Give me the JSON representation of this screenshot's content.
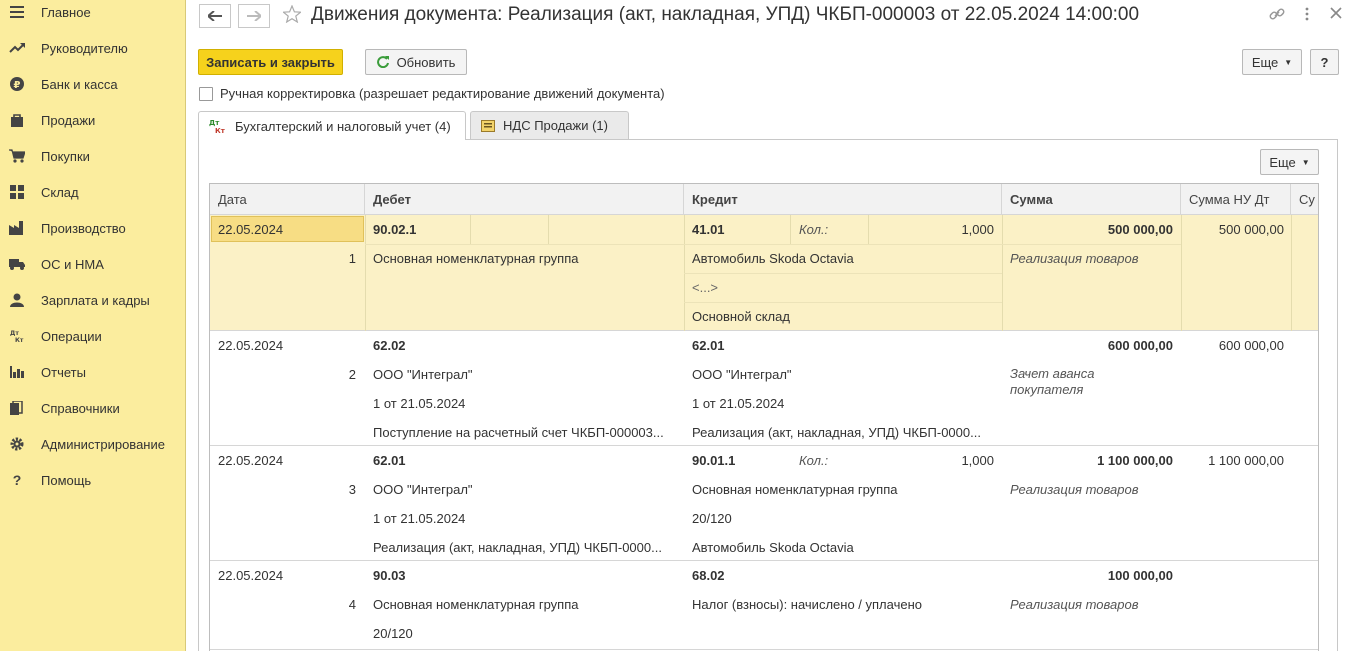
{
  "sidebar": {
    "items": [
      {
        "label": "Главное",
        "icon": "menu-icon"
      },
      {
        "label": "Руководителю",
        "icon": "trend-icon"
      },
      {
        "label": "Банк и касса",
        "icon": "ruble-icon"
      },
      {
        "label": "Продажи",
        "icon": "bag-icon"
      },
      {
        "label": "Покупки",
        "icon": "cart-icon"
      },
      {
        "label": "Склад",
        "icon": "warehouse-icon"
      },
      {
        "label": "Производство",
        "icon": "factory-icon"
      },
      {
        "label": "ОС и НМА",
        "icon": "truck-icon"
      },
      {
        "label": "Зарплата и кадры",
        "icon": "person-icon"
      },
      {
        "label": "Операции",
        "icon": "dt-kt-icon"
      },
      {
        "label": "Отчеты",
        "icon": "bar-chart-icon"
      },
      {
        "label": "Справочники",
        "icon": "books-icon"
      },
      {
        "label": "Администрирование",
        "icon": "gear-icon"
      },
      {
        "label": "Помощь",
        "icon": "question-icon"
      }
    ]
  },
  "header": {
    "title": "Движения документа: Реализация (акт, накладная, УПД) ЧКБП-000003 от 22.05.2024 14:00:00"
  },
  "toolbar": {
    "save_close": "Записать и закрыть",
    "refresh": "Обновить",
    "more": "Еще",
    "help": "?",
    "manual_edit": "Ручная корректировка (разрешает редактирование движений документа)"
  },
  "tabs": [
    {
      "label": "Бухгалтерский и налоговый учет (4)",
      "icon_top": "Дт",
      "icon_bottom": "Кт"
    },
    {
      "label": "НДС Продажи (1)"
    }
  ],
  "grid": {
    "more": "Еще",
    "columns": [
      "Дата",
      "Дебет",
      "Кредит",
      "Сумма",
      "Сумма НУ Дт",
      "Су"
    ],
    "rows": [
      {
        "date": "22.05.2024",
        "num": "1",
        "debit": [
          "90.02.1",
          "Основная номенклатурная группа",
          "",
          ""
        ],
        "credit": [
          "41.01",
          "Автомобиль Skoda Octavia",
          "<...>",
          "Основной склад"
        ],
        "qty_label": "Кол.:",
        "qty": "1,000",
        "sum": "500 000,00",
        "content": "Реализация товаров",
        "sum_nu": "500 000,00"
      },
      {
        "date": "22.05.2024",
        "num": "2",
        "debit": [
          "62.02",
          "ООО \"Интеграл\"",
          "1 от 21.05.2024",
          "Поступление на расчетный счет ЧКБП-000003..."
        ],
        "credit": [
          "62.01",
          "ООО \"Интеграл\"",
          "1 от 21.05.2024",
          "Реализация (акт, накладная, УПД) ЧКБП-0000..."
        ],
        "qty_label": "",
        "qty": "",
        "sum": "600 000,00",
        "content": "Зачет аванса",
        "content2": "покупателя",
        "sum_nu": "600 000,00"
      },
      {
        "date": "22.05.2024",
        "num": "3",
        "debit": [
          "62.01",
          "ООО \"Интеграл\"",
          "1 от 21.05.2024",
          "Реализация (акт, накладная, УПД) ЧКБП-0000..."
        ],
        "credit": [
          "90.01.1",
          "Основная номенклатурная группа",
          "20/120",
          "Автомобиль Skoda Octavia"
        ],
        "qty_label": "Кол.:",
        "qty": "1,000",
        "sum": "1 100 000,00",
        "content": "Реализация товаров",
        "sum_nu": "1 100 000,00"
      },
      {
        "date": "22.05.2024",
        "num": "4",
        "debit": [
          "90.03",
          "Основная номенклатурная группа",
          "20/120",
          ""
        ],
        "credit": [
          "68.02",
          "Налог (взносы): начислено / уплачено",
          "",
          ""
        ],
        "qty_label": "",
        "qty": "",
        "sum": "100 000,00",
        "content": "Реализация товаров",
        "sum_nu": ""
      }
    ]
  }
}
